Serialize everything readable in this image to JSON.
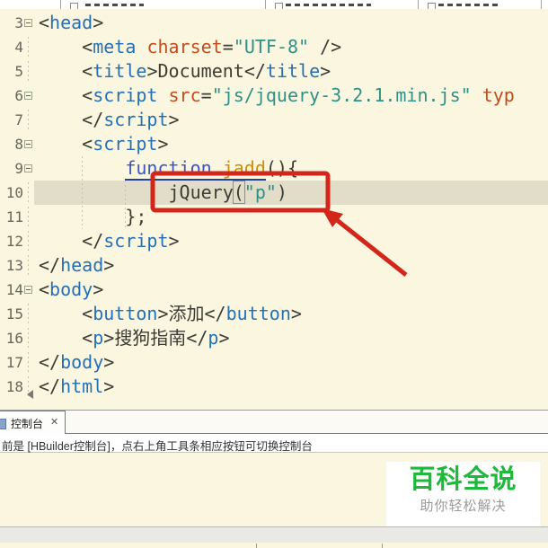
{
  "editor": {
    "background": "#FBF6E0",
    "current_line_bg": "#E2DDC8",
    "current_line": "10",
    "lines": [
      {
        "num": "3",
        "fold": true,
        "tokens": [
          [
            "<",
            "pln"
          ],
          [
            "head",
            "tag"
          ],
          [
            ">",
            "pln"
          ]
        ]
      },
      {
        "num": "4",
        "tokens": [
          [
            "    <",
            "pln"
          ],
          [
            "meta",
            "tag"
          ],
          [
            " ",
            "pln"
          ],
          [
            "charset",
            "attr"
          ],
          [
            "=",
            "pln"
          ],
          [
            "\"UTF-8\"",
            "str"
          ],
          [
            " />",
            "pln"
          ]
        ]
      },
      {
        "num": "5",
        "tokens": [
          [
            "    <",
            "pln"
          ],
          [
            "title",
            "tag"
          ],
          [
            ">",
            "pln"
          ],
          [
            "Document",
            "pln"
          ],
          [
            "</",
            "pln"
          ],
          [
            "title",
            "tag"
          ],
          [
            ">",
            "pln"
          ]
        ]
      },
      {
        "num": "6",
        "fold": true,
        "tokens": [
          [
            "    <",
            "pln"
          ],
          [
            "script",
            "tag"
          ],
          [
            " ",
            "pln"
          ],
          [
            "src",
            "attr"
          ],
          [
            "=",
            "pln"
          ],
          [
            "\"js/jquery-3.2.1.min.js\"",
            "str"
          ],
          [
            " ",
            "pln"
          ],
          [
            "typ",
            "attr"
          ]
        ]
      },
      {
        "num": "7",
        "tokens": [
          [
            "    </",
            "pln"
          ],
          [
            "script",
            "tag"
          ],
          [
            ">",
            "pln"
          ]
        ]
      },
      {
        "num": "8",
        "fold": true,
        "tokens": [
          [
            "    <",
            "pln"
          ],
          [
            "script",
            "tag"
          ],
          [
            ">",
            "pln"
          ]
        ]
      },
      {
        "num": "9",
        "fold": true,
        "tokens": [
          [
            "        ",
            "pln"
          ],
          [
            "function",
            "kw",
            "u"
          ],
          [
            " ",
            "pln",
            "u"
          ],
          [
            "jadd",
            "fn",
            "u"
          ],
          [
            "(){",
            "pln"
          ]
        ]
      },
      {
        "num": "10",
        "tokens": [
          [
            "            ",
            "pln"
          ],
          [
            "jQuery",
            "pln"
          ],
          [
            "(",
            "pln",
            "box"
          ],
          [
            "\"p\"",
            "str"
          ],
          [
            ")",
            "pln"
          ]
        ]
      },
      {
        "num": "11",
        "tokens": [
          [
            "        };",
            "pln"
          ]
        ]
      },
      {
        "num": "12",
        "tokens": [
          [
            "    </",
            "pln"
          ],
          [
            "script",
            "tag"
          ],
          [
            ">",
            "pln"
          ]
        ]
      },
      {
        "num": "13",
        "tokens": [
          [
            "</",
            "pln"
          ],
          [
            "head",
            "tag"
          ],
          [
            ">",
            "pln"
          ]
        ]
      },
      {
        "num": "14",
        "fold": true,
        "tokens": [
          [
            "<",
            "pln"
          ],
          [
            "body",
            "tag"
          ],
          [
            ">",
            "pln"
          ]
        ]
      },
      {
        "num": "15",
        "tokens": [
          [
            "    <",
            "pln"
          ],
          [
            "button",
            "tag"
          ],
          [
            ">",
            "pln"
          ],
          [
            "添加",
            "pln"
          ],
          [
            "</",
            "pln"
          ],
          [
            "button",
            "tag"
          ],
          [
            ">",
            "pln"
          ]
        ]
      },
      {
        "num": "16",
        "tokens": [
          [
            "    <",
            "pln"
          ],
          [
            "p",
            "tag"
          ],
          [
            ">",
            "pln"
          ],
          [
            "搜狗指南",
            "pln"
          ],
          [
            "</",
            "pln"
          ],
          [
            "p",
            "tag"
          ],
          [
            ">",
            "pln"
          ]
        ]
      },
      {
        "num": "17",
        "tokens": [
          [
            "</",
            "pln"
          ],
          [
            "body",
            "tag"
          ],
          [
            ">",
            "pln"
          ]
        ]
      },
      {
        "num": "18",
        "tokens": [
          [
            "</",
            "pln"
          ],
          [
            "html",
            "tag"
          ],
          [
            ">",
            "pln"
          ]
        ]
      }
    ]
  },
  "annotation": {
    "color": "#d3261b"
  },
  "console": {
    "tab_label": "控制台",
    "close_label": "✕",
    "message": "前是 [HBuilder控制台]，点右上角工具条相应按钮可切换控制台"
  },
  "watermark": {
    "title": "百科全说",
    "subtitle": "助你轻松解决",
    "title_color": "#1eb83a"
  }
}
